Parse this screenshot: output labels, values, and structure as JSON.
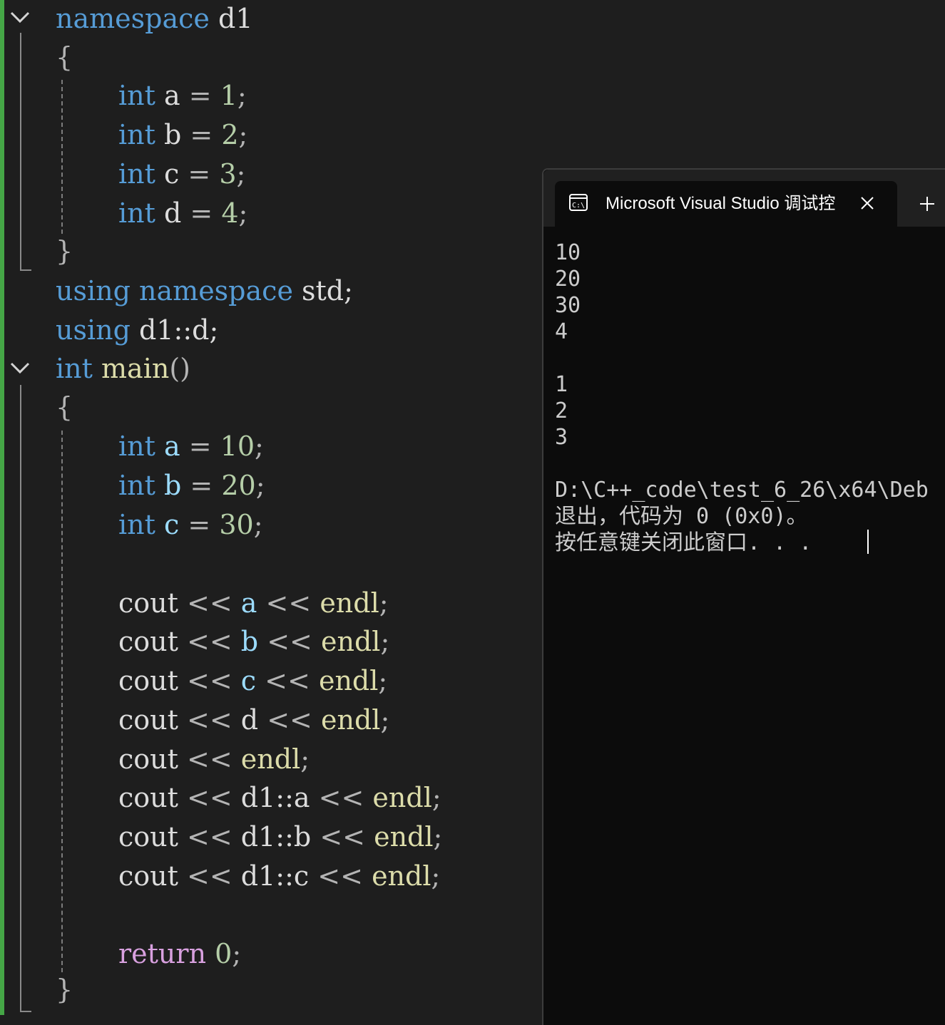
{
  "editor": {
    "ns_kw": "namespace",
    "ns_name": "d1",
    "open_brace": "{",
    "close_brace": "}",
    "int_kw": "int",
    "ns_vars": [
      {
        "name": "a",
        "value": "1"
      },
      {
        "name": "b",
        "value": "2"
      },
      {
        "name": "c",
        "value": "3"
      },
      {
        "name": "d",
        "value": "4"
      }
    ],
    "using_kw": "using",
    "using_ns_kw": "namespace",
    "using_ns_target": "std;",
    "using_decl": "d1::d;",
    "main_name": "main",
    "main_parens": "()",
    "local_vars": [
      {
        "name": "a",
        "value": "10"
      },
      {
        "name": "b",
        "value": "20"
      },
      {
        "name": "c",
        "value": "30"
      }
    ],
    "cout": "cout",
    "shift": "<<",
    "endl": "endl",
    "semicolon": ";",
    "eq": "=",
    "cout_args": [
      "a",
      "b",
      "c",
      "d"
    ],
    "cout_scoped_prefix": "d1::",
    "cout_scoped_args": [
      "a",
      "b",
      "c"
    ],
    "return_kw": "return",
    "return_value": "0"
  },
  "console": {
    "tab_title": "Microsoft Visual Studio 调试控",
    "tab_icon": "terminal-icon",
    "close_icon": "close-icon",
    "new_tab_icon": "plus-icon",
    "output_lines": [
      "10",
      "20",
      "30",
      "4",
      "",
      "1",
      "2",
      "3",
      "",
      "D:\\C++_code\\test_6_26\\x64\\Deb",
      "退出，代码为 0 (0x0)。",
      "按任意键关闭此窗口. . ."
    ]
  }
}
